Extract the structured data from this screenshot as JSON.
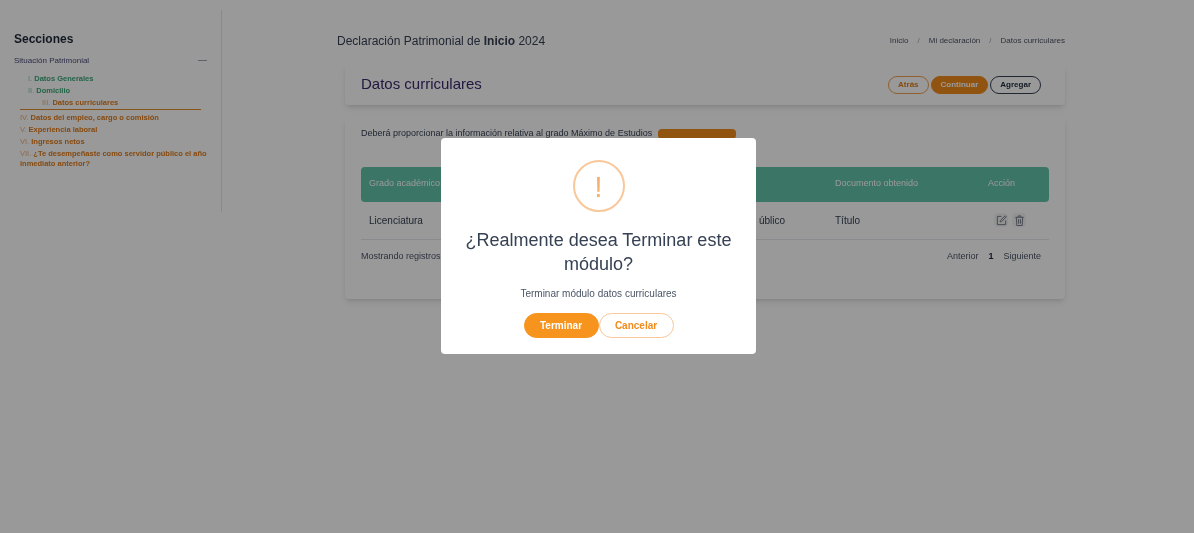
{
  "sidebar": {
    "title": "Secciones",
    "group": {
      "label": "Situación Patrimonial",
      "toggle": "—",
      "expanded": true,
      "items": [
        {
          "number": "I.",
          "label": "Datos Generales",
          "kind": "done",
          "selected": false
        },
        {
          "number": "II.",
          "label": "Domicilio",
          "kind": "done",
          "selected": false
        },
        {
          "number": "III.",
          "label": "Datos curriculares",
          "kind": "pending",
          "selected": true
        },
        {
          "number": "IV.",
          "label": "Datos del empleo, cargo o comisión",
          "kind": "pending",
          "selected": false
        },
        {
          "number": "V.",
          "label": "Experiencia laboral",
          "kind": "pending",
          "selected": false
        },
        {
          "number": "VI.",
          "label": "Ingresos netos",
          "kind": "pending",
          "selected": false
        },
        {
          "number": "VII.",
          "label": "¿Te desempeñaste como servidor público el año inmediato anterior?",
          "kind": "pending",
          "selected": false
        }
      ]
    }
  },
  "header": {
    "title": "Declaración Patrimonial de **Inicio** 2024",
    "breadcrumb": [
      "Inicio",
      "Mi declaración",
      "Datos curriculares"
    ],
    "separator": "/"
  },
  "section": {
    "title": "Datos curriculares",
    "buttons": [
      {
        "label": "Atrás",
        "kind": "outline"
      },
      {
        "label": "Continuar",
        "kind": "primary"
      },
      {
        "label": "Agregar",
        "kind": "dark"
      }
    ]
  },
  "content": {
    "notice": "Deberá proporcionar la información relativa al grado Máximo de Estudios",
    "table": {
      "columns": [
        "Grado académico",
        "",
        "Documento obtenido",
        "Acción"
      ],
      "rows": [
        {
          "cells": [
            "Licenciatura",
            "úblico",
            "Título"
          ]
        }
      ]
    },
    "footer": "Mostrando registros",
    "pagination": {
      "previous": "Anterior",
      "page": "1",
      "next": "Siguiente"
    }
  },
  "dialog": {
    "icon": "!",
    "title": "¿Realmente desea Terminar este módulo?",
    "message": "Terminar módulo datos curriculares",
    "buttons": [
      {
        "label": "Terminar",
        "kind": "primary"
      },
      {
        "label": "Cancelar",
        "kind": "outline"
      }
    ]
  }
}
